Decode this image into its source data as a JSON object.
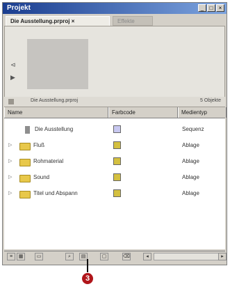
{
  "window": {
    "title": "Projekt",
    "buttons": [
      "_",
      "□",
      "×"
    ]
  },
  "tabs": [
    {
      "label": "Die Ausstellung.prproj ×",
      "active": true
    },
    {
      "label": "Effekte",
      "active": false
    }
  ],
  "preview": {
    "controls": [
      "⊲",
      "▶"
    ]
  },
  "info": {
    "project_name": "Die Ausstellung.prproj",
    "item_count": "5 Objekte"
  },
  "columns": [
    "Name",
    "Farbcode",
    "Medientyp"
  ],
  "items": [
    {
      "name": "Die Ausstellung",
      "type": "Sequenz",
      "icon": "sequence-icon",
      "label_color": "#c8c8f0",
      "expand": ""
    },
    {
      "name": "Fluß",
      "type": "Ablage",
      "icon": "folder-icon",
      "label_color": "#d4c040",
      "expand": "▷"
    },
    {
      "name": "Rohmaterial",
      "type": "Ablage",
      "icon": "folder-icon",
      "label_color": "#d4c040",
      "expand": "▷"
    },
    {
      "name": "Sound",
      "type": "Ablage",
      "icon": "folder-icon",
      "label_color": "#d4c040",
      "expand": "▷"
    },
    {
      "name": "Titel und Abspann",
      "type": "Ablage",
      "icon": "folder-icon",
      "label_color": "#d4c040",
      "expand": "▷"
    }
  ],
  "bottom_buttons": [
    "list-view-icon",
    "icon-view-icon",
    "automate-icon",
    "find-icon",
    "new-bin-icon",
    "new-item-icon",
    "delete-icon"
  ],
  "callout": "3"
}
